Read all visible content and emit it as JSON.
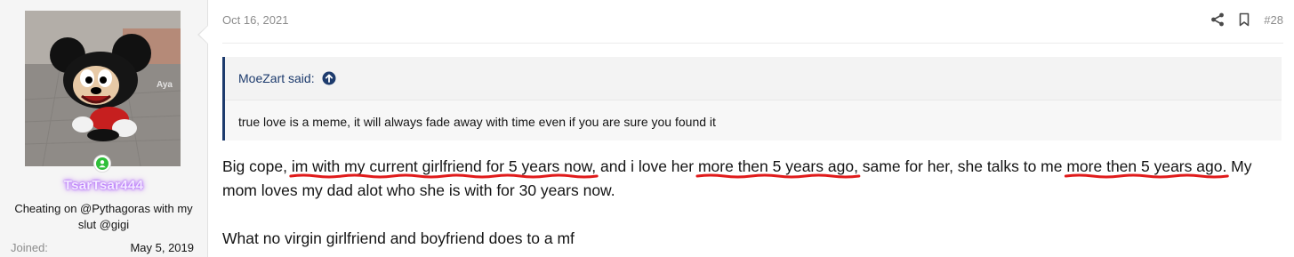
{
  "user": {
    "avatar_caption": "Aya",
    "username": "TsarTsar444",
    "title": "Cheating on @Pythagoras with my slut @gigi",
    "joined_label": "Joined:",
    "joined_value": "May 5, 2019",
    "online_color": "#2fbf3a"
  },
  "post": {
    "date": "Oct 16, 2021",
    "number": "#28",
    "share_icon": "share-icon",
    "bookmark_icon": "bookmark-icon"
  },
  "quote": {
    "author": "MoeZart said:",
    "jump_icon": "arrow-up-circle-icon",
    "text": "true love is a meme, it will always fade away with time even if you are sure you found it"
  },
  "message": {
    "para1": [
      {
        "text": "Big cope, ",
        "marked": false
      },
      {
        "text": "im with my current girlfriend for 5 years now,",
        "marked": true
      },
      {
        "text": " and i love her ",
        "marked": false
      },
      {
        "text": "more then 5 years ago,",
        "marked": true
      },
      {
        "text": " same for her, she talks to me ",
        "marked": false
      },
      {
        "text": "more then 5 years ago.",
        "marked": true
      },
      {
        "text": " My mom loves my dad alot who she is with for 30 years now.",
        "marked": false
      }
    ],
    "para2": "What no virgin girlfriend and boyfriend does to a mf",
    "underline_color": "#e01b1b"
  }
}
